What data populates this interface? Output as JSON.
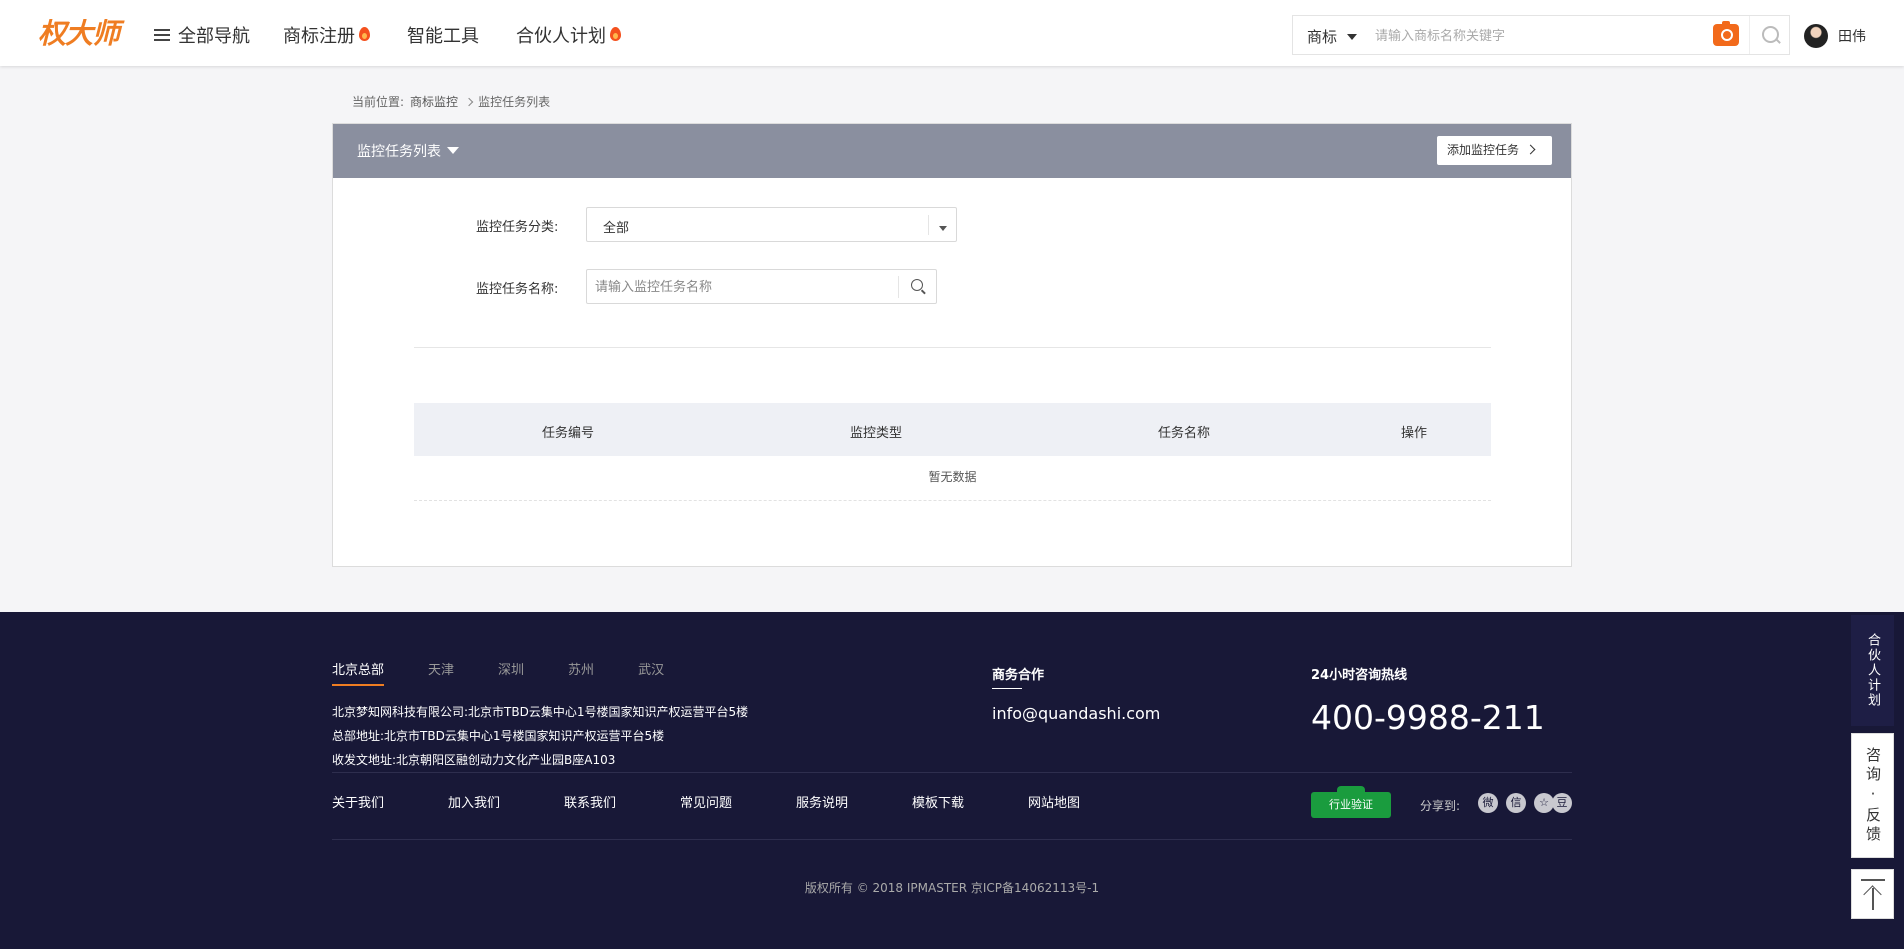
{
  "header": {
    "logo_text": "权大师",
    "nav_all": "全部导航",
    "nav_register": "商标注册",
    "nav_tools": "智能工具",
    "nav_partner": "合伙人计划",
    "search_type": "商标",
    "search_placeholder": "请输入商标名称关键字",
    "user_name": "田伟"
  },
  "breadcrumb": {
    "prefix": "当前位置:",
    "parent": "商标监控",
    "current": "监控任务列表"
  },
  "panel": {
    "title": "监控任务列表",
    "add_button": "添加监控任务",
    "category_label": "监控任务分类:",
    "category_value": "全部",
    "name_label": "监控任务名称:",
    "name_placeholder": "请输入监控任务名称",
    "columns": [
      "任务编号",
      "监控类型",
      "任务名称",
      "操作"
    ],
    "empty_text": "暂无数据"
  },
  "footer": {
    "tabs": [
      "北京总部",
      "天津",
      "深圳",
      "苏州",
      "武汉"
    ],
    "active_tab": "北京总部",
    "address_lines": [
      "北京梦知网科技有限公司:北京市TBD云集中心1号楼国家知识产权运营平台5楼",
      "总部地址:北京市TBD云集中心1号楼国家知识产权运营平台5楼",
      "收发文地址:北京朝阳区融创动力文化产业园B座A103"
    ],
    "biz_title": "商务合作",
    "biz_email": "info@quandashi.com",
    "hotline_title": "24小时咨询热线",
    "hotline_number": "400-9988-211",
    "links": [
      "关于我们",
      "加入我们",
      "联系我们",
      "常见问题",
      "服务说明",
      "模板下载",
      "网站地图"
    ],
    "badge_text": "行业验证",
    "share_label": "分享到:",
    "share_icons": [
      "weibo-icon",
      "wechat-icon",
      "qzone-icon",
      "douban-icon"
    ],
    "share_glyphs": [
      "微",
      "信",
      "☆",
      "豆"
    ],
    "copyright": "版权所有 © 2018 IPMASTER 京ICP备14062113号-1"
  },
  "float": {
    "partner": "合伙人计划",
    "feedback": "咨询·反馈"
  },
  "colors": {
    "brand_orange": "#ef7d22",
    "panel_header": "#8a8f9f",
    "footer_bg": "#181837"
  }
}
